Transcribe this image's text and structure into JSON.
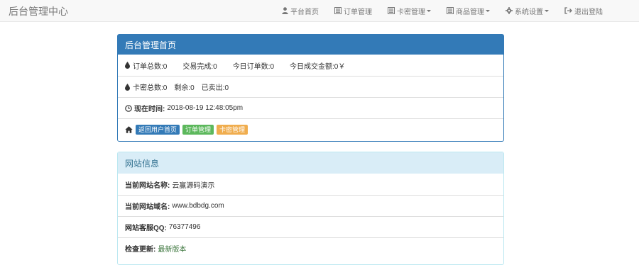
{
  "navbar": {
    "brand": "后台管理中心",
    "items": [
      {
        "label": "平台首页",
        "icon": "user-icon",
        "dropdown": false
      },
      {
        "label": "订单管理",
        "icon": "list-icon",
        "dropdown": false
      },
      {
        "label": "卡密管理",
        "icon": "list-icon",
        "dropdown": true
      },
      {
        "label": "商品管理",
        "icon": "list-icon",
        "dropdown": true
      },
      {
        "label": "系统设置",
        "icon": "gear-icon",
        "dropdown": true
      },
      {
        "label": "退出登陆",
        "icon": "logout-icon",
        "dropdown": false
      }
    ]
  },
  "admin_panel": {
    "title": "后台管理首页",
    "orders_row": {
      "total_orders": "订单总数:0",
      "completed": "交易完成:0",
      "today_orders": "今日订单数:0",
      "today_amount": "今日成交金额:0￥"
    },
    "cards_row": {
      "total_cards": "卡密总数:0",
      "remaining": "剩余:0",
      "sold": "已卖出:0"
    },
    "time_row": {
      "label": "现在时间:",
      "value": "2018-08-19 12:48:05pm"
    },
    "actions": {
      "user_home": "返回用户首页",
      "order_manage": "订单管理",
      "card_manage": "卡密管理"
    }
  },
  "site_panel": {
    "title": "网站信息",
    "name_label": "当前网站名称:",
    "name_value": "云赢源码演示",
    "domain_label": "当前网站域名:",
    "domain_value": "www.bdbdg.com",
    "qq_label": "网站客服QQ:",
    "qq_value": "76377496",
    "update_label": "检查更新:",
    "update_value": "最新版本"
  },
  "colors": {
    "primary": "#337ab7",
    "success": "#5cb85c",
    "warning": "#f0ad4e",
    "info_bg": "#d9edf7"
  }
}
